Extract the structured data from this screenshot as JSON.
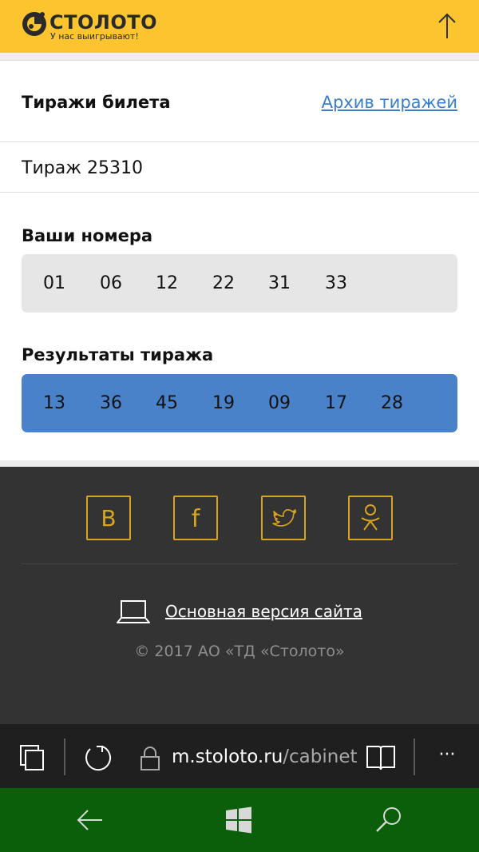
{
  "header": {
    "logo_name": "СТОЛОТО",
    "logo_slogan": "У нас выигрывают!",
    "logo_icon": "stoloto-logo-icon",
    "up_icon": "arrow-up-icon",
    "brand_color": "#fcc530"
  },
  "ticket": {
    "title": "Тиражи билета",
    "archive_link": "Архив тиражей",
    "draw_label": "Тираж 25310"
  },
  "your_numbers": {
    "title": "Ваши номера",
    "values": [
      "01",
      "06",
      "12",
      "22",
      "31",
      "33"
    ]
  },
  "results": {
    "title": "Результаты тиража",
    "values": [
      "13",
      "36",
      "45",
      "19",
      "09",
      "17",
      "28"
    ],
    "color": "#4a82c9"
  },
  "footer": {
    "social": [
      {
        "name": "vk-icon",
        "glyph": "B"
      },
      {
        "name": "facebook-icon",
        "glyph": "f"
      },
      {
        "name": "twitter-icon",
        "glyph": ""
      },
      {
        "name": "odnoklassniki-icon",
        "glyph": ""
      }
    ],
    "main_version_link": "Основная версия сайта",
    "laptop_icon": "laptop-icon",
    "copyright": "© 2017 АО «ТД «Столото»",
    "accent_color": "#d9a41f"
  },
  "browser": {
    "url_domain": "m.stoloto.ru",
    "url_path": "/cabinet",
    "icons": [
      "tabs-icon",
      "refresh-icon",
      "lock-icon",
      "reading-view-icon",
      "more-icon"
    ],
    "more_label": "···"
  },
  "nav": {
    "icons": [
      "back-arrow-icon",
      "windows-start-icon",
      "search-icon"
    ],
    "color": "#0b5f0b"
  }
}
